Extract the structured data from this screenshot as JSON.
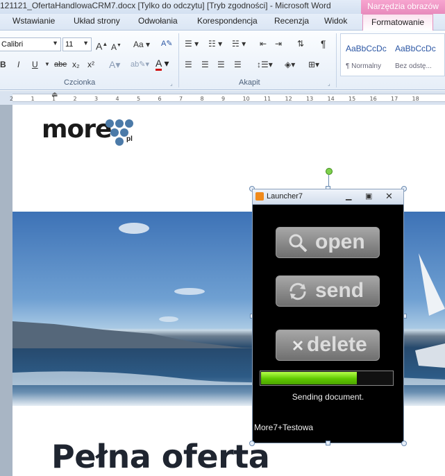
{
  "window": {
    "title": "121121_OfertaHandlowaCRM7.docx [Tylko do odczytu] [Tryb zgodności]  -  Microsoft Word",
    "contextual_tab": "Narzędzia obrazów"
  },
  "tabs": [
    "Wstawianie",
    "Układ strony",
    "Odwołania",
    "Korespondencja",
    "Recenzja",
    "Widok",
    "Formatowanie"
  ],
  "ribbon": {
    "font_name": "Calibri",
    "font_size": "11",
    "group_font": "Czcionka",
    "group_paragraph": "Akapit",
    "styles": [
      {
        "sample": "AaBbCcDc",
        "name": "¶ Normalny"
      },
      {
        "sample": "AaBbCcDc",
        "name": "Bez odstę..."
      }
    ],
    "buttons": {
      "grow": "A",
      "shrink": "A",
      "case": "Aa",
      "bold": "B",
      "italic": "I",
      "underline": "U",
      "strike": "abe",
      "subscript": "x₂",
      "superscript": "x²",
      "font_color": "A",
      "pilcrow": "¶"
    }
  },
  "ruler": {
    "numbers": [
      "2",
      "1",
      "1",
      "2",
      "3",
      "4",
      "5",
      "6",
      "7",
      "8",
      "9",
      "10",
      "11",
      "12",
      "13",
      "14",
      "15",
      "16",
      "17",
      "18"
    ]
  },
  "document": {
    "logo_text": "more",
    "logo_suffix": "pl",
    "heading": "Pełna oferta"
  },
  "launcher": {
    "title": "Launcher7",
    "buttons": {
      "open": "open",
      "send": "send",
      "delete": "delete"
    },
    "progress": 0.72,
    "status": "Sending document.",
    "user": "More7+Testowa"
  }
}
